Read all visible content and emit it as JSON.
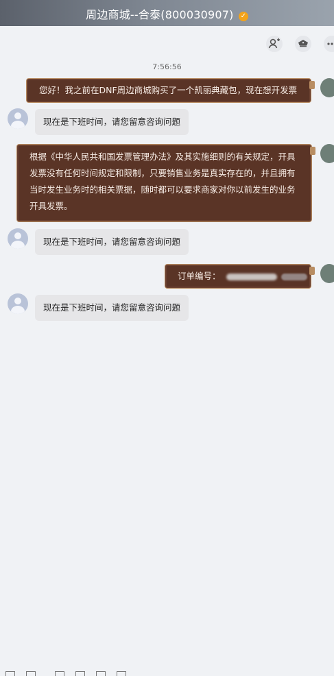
{
  "window": {
    "title": "周边商城--合泰(800030907)",
    "verified_badge": "✓"
  },
  "toolbar": {
    "icons": [
      "add-user-icon",
      "police-hat-icon",
      "more-icon"
    ]
  },
  "chat": {
    "timestamp": "7:56:56",
    "messages": [
      {
        "side": "right",
        "style": "brown",
        "text": "您好！我之前在DNF周边商城购买了一个凯丽典藏包，现在想开发票"
      },
      {
        "side": "left",
        "style": "gray",
        "text": "现在是下班时间，请您留意咨询问题"
      },
      {
        "side": "right",
        "style": "brown",
        "lines": [
          "根据《中华人民共和国发票管理办法》及其实施细则的有关规定，开具",
          "发票没有任何时间规定和限制，只要销售业务是真实存在的，并且拥有",
          "当时发生业务时的相关票据，随时都可以要求商家对你以前发生的业务",
          "开具发票。"
        ]
      },
      {
        "side": "left",
        "style": "gray",
        "text": "现在是下班时间，请您留意咨询问题"
      },
      {
        "side": "right",
        "style": "brown",
        "text": "订单编号："
      },
      {
        "side": "left",
        "style": "gray",
        "text": "现在是下班时间，请您留意咨询问题"
      }
    ]
  }
}
